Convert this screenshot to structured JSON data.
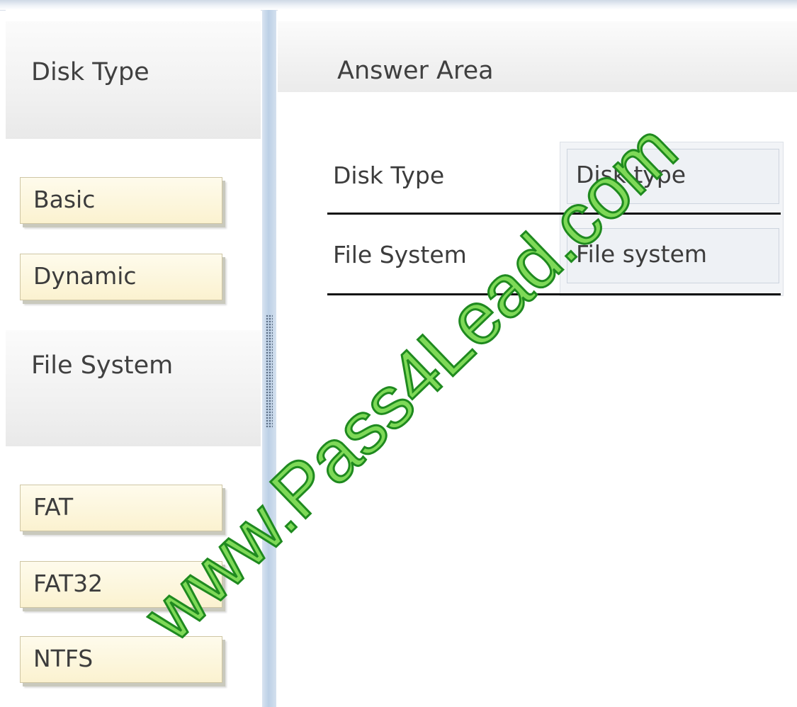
{
  "source_panel": {
    "sections": [
      {
        "header": "Disk Type",
        "items": [
          "Basic",
          "Dynamic"
        ]
      },
      {
        "header": "File System",
        "items": [
          "FAT",
          "FAT32",
          "NTFS"
        ]
      }
    ]
  },
  "answer_area": {
    "title": "Answer Area",
    "rows": [
      {
        "label": "Disk Type",
        "target": "Disk type"
      },
      {
        "label": "File System",
        "target": "File system"
      }
    ]
  },
  "watermark": "www.Pass4Lead.com",
  "colors": {
    "item_background": "#fbf2d0",
    "splitter": "#bcd0e6",
    "watermark_fill": "#7ed957",
    "watermark_stroke": "#1f8a1f"
  }
}
